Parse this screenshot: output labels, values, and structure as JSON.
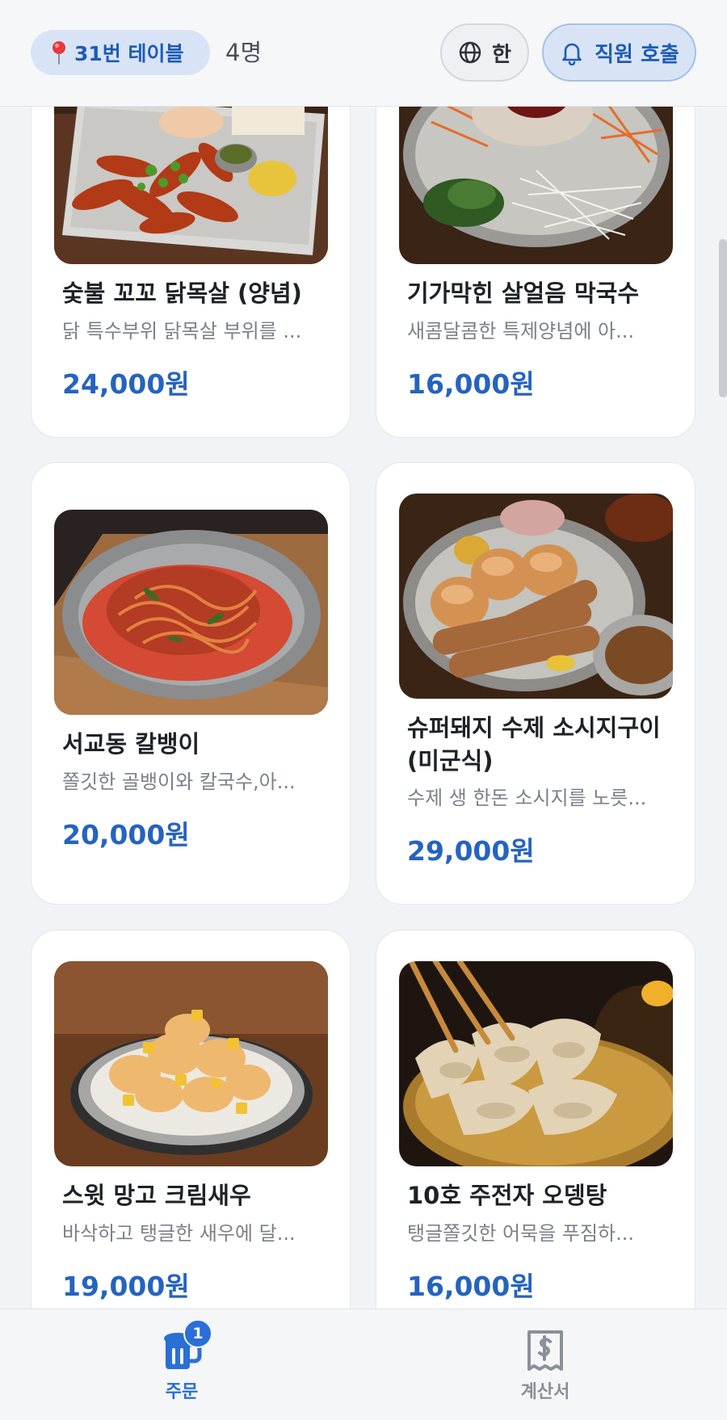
{
  "header": {
    "table_label": "31번 테이블",
    "guest_count": "4명",
    "language_label": "한",
    "call_staff_label": "직원 호출"
  },
  "menu": {
    "items": [
      {
        "name": "숯불 꼬꼬 닭목살 (양념)",
        "description": "닭 특수부위 닭목살 부위를 ...",
        "price": "24,000원"
      },
      {
        "name": "기가막힌 살얼음 막국수",
        "description": "새콤달콤한 특제양념에 아...",
        "price": "16,000원"
      },
      {
        "name": "서교동 칼뱅이",
        "description": "쫄깃한 골뱅이와 칼국수,아...",
        "price": "20,000원"
      },
      {
        "name": "슈퍼돼지 수제 소시지구이 (미군식)",
        "description": "수제 생 한돈 소시지를 노릇...",
        "price": "29,000원"
      },
      {
        "name": "스윗 망고 크림새우",
        "description": "바삭하고 탱글한 새우에 달...",
        "price": "19,000원"
      },
      {
        "name": "10호 주전자 오뎅탕",
        "description": "탱글쫄깃한 어묵을 푸짐하...",
        "price": "16,000원"
      }
    ]
  },
  "bottom_nav": {
    "order_label": "주문",
    "order_badge": "1",
    "bill_label": "계산서"
  },
  "colors": {
    "accent": "#2563c0",
    "chip_bg": "#d8e4f6",
    "active_tab": "#2a6fd6",
    "inactive_tab": "#8a8f98"
  },
  "icons": [
    "pin-icon",
    "globe-icon",
    "bell-icon",
    "beer-mug-icon",
    "receipt-icon"
  ]
}
